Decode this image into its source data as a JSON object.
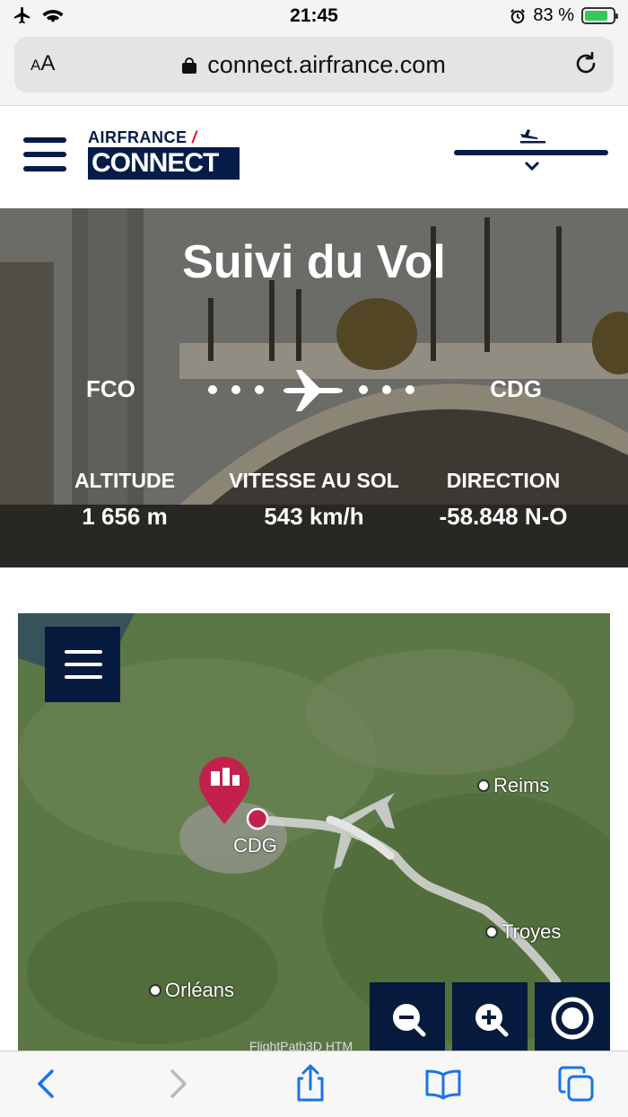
{
  "status_bar": {
    "time": "21:45",
    "battery_percent": "83 %",
    "battery_level": 0.83
  },
  "browser": {
    "aa_label_small": "A",
    "aa_label": "A",
    "url": "connect.airfrance.com"
  },
  "header": {
    "logo_top": "AIRFRANCE",
    "logo_bottom": "CONNECT",
    "flight_progress": 1.0
  },
  "hero": {
    "title": "Suivi du Vol",
    "origin": "FCO",
    "destination": "CDG",
    "stats": [
      {
        "label": "ALTITUDE",
        "value": "1 656 m"
      },
      {
        "label": "VITESSE AU SOL",
        "value": "543 km/h"
      },
      {
        "label": "DIRECTION",
        "value": "-58.848 N-O"
      }
    ]
  },
  "map": {
    "airport_label": "CDG",
    "cities": [
      "Reims",
      "Troyes",
      "Orléans"
    ],
    "credit": "FlightPath3D HTM"
  },
  "colors": {
    "navy": "#051c48",
    "air_france_red": "#e10e1e",
    "airport_pin": "#c3204e",
    "ios_blue": "#1a73e8"
  },
  "icons": {
    "status_left": [
      "airplane-mode-icon",
      "wifi-icon"
    ],
    "status_right": [
      "alarm-icon",
      "battery-icon"
    ],
    "browser": [
      "lock-icon",
      "reload-icon"
    ],
    "map_controls": [
      "zoom-out-icon",
      "zoom-in-icon",
      "recenter-icon"
    ],
    "toolbar": [
      "back-icon",
      "forward-icon",
      "share-icon",
      "bookmarks-icon",
      "tabs-icon"
    ]
  }
}
